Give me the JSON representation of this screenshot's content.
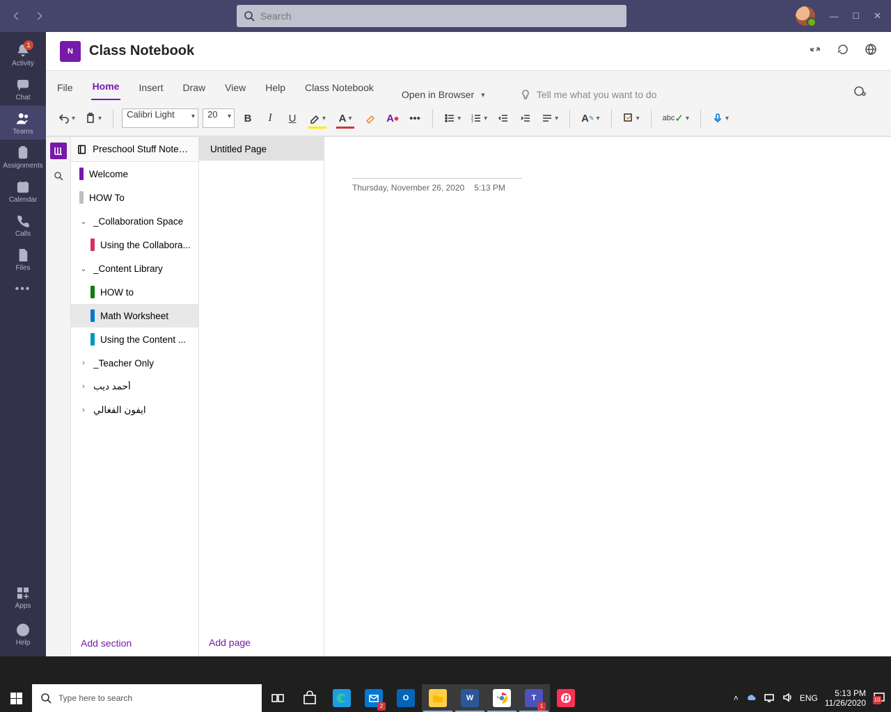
{
  "titlebar": {
    "search_placeholder": "Search"
  },
  "rail": {
    "items": [
      {
        "label": "Activity",
        "badge": "1"
      },
      {
        "label": "Chat"
      },
      {
        "label": "Teams"
      },
      {
        "label": "Assignments"
      },
      {
        "label": "Calendar"
      },
      {
        "label": "Calls"
      },
      {
        "label": "Files"
      }
    ],
    "apps_label": "Apps",
    "help_label": "Help"
  },
  "tab": {
    "title": "Class Notebook",
    "icon_text": "N"
  },
  "ribbon": {
    "tabs": [
      "File",
      "Home",
      "Insert",
      "Draw",
      "View",
      "Help",
      "Class Notebook"
    ],
    "active_index": 1,
    "open_in_browser": "Open in Browser",
    "tellme": "Tell me what you want to do"
  },
  "toolbar": {
    "font_name": "Calibri Light",
    "font_size": "20"
  },
  "notebook": {
    "title": "Preschool Stuff Notebook",
    "sections": [
      {
        "label": "Welcome",
        "color": "#7719aa",
        "kind": "section"
      },
      {
        "label": "HOW To",
        "color": "#bfbfbf",
        "kind": "section"
      },
      {
        "label": "_Collaboration Space",
        "kind": "group",
        "expanded": true
      },
      {
        "label": "Using the Collabora...",
        "color": "#d13460",
        "kind": "section",
        "indent": true
      },
      {
        "label": "_Content Library",
        "kind": "group",
        "expanded": true
      },
      {
        "label": "HOW to",
        "color": "#107c10",
        "kind": "section",
        "indent": true
      },
      {
        "label": "Math Worksheet",
        "color": "#0078d4",
        "kind": "section",
        "indent": true,
        "selected": true
      },
      {
        "label": "Using the Content ...",
        "color": "#0099bc",
        "kind": "section",
        "indent": true
      },
      {
        "label": "_Teacher Only",
        "kind": "group",
        "expanded": false
      },
      {
        "label": "أحمد ديب",
        "kind": "group",
        "expanded": false
      },
      {
        "label": "ايفون الفغالي",
        "kind": "group",
        "expanded": false
      }
    ],
    "add_section": "Add section",
    "pages": {
      "items": [
        {
          "label": "Untitled Page",
          "selected": true
        }
      ],
      "add_page": "Add page"
    },
    "page": {
      "date": "Thursday, November 26, 2020",
      "time": "5:13 PM"
    }
  },
  "taskbar": {
    "search_placeholder": "Type here to search",
    "apps": [
      {
        "name": "task-view"
      },
      {
        "name": "store"
      },
      {
        "name": "edge"
      },
      {
        "name": "mail",
        "badge": "2"
      },
      {
        "name": "outlook"
      },
      {
        "name": "file-explorer",
        "active": true
      },
      {
        "name": "word",
        "active": true
      },
      {
        "name": "chrome",
        "active": true
      },
      {
        "name": "teams",
        "active": true,
        "badge": "1"
      },
      {
        "name": "itunes"
      }
    ],
    "lang": "ENG",
    "clock_time": "5:13 PM",
    "clock_date": "11/26/2020",
    "notif_badge": "10"
  }
}
